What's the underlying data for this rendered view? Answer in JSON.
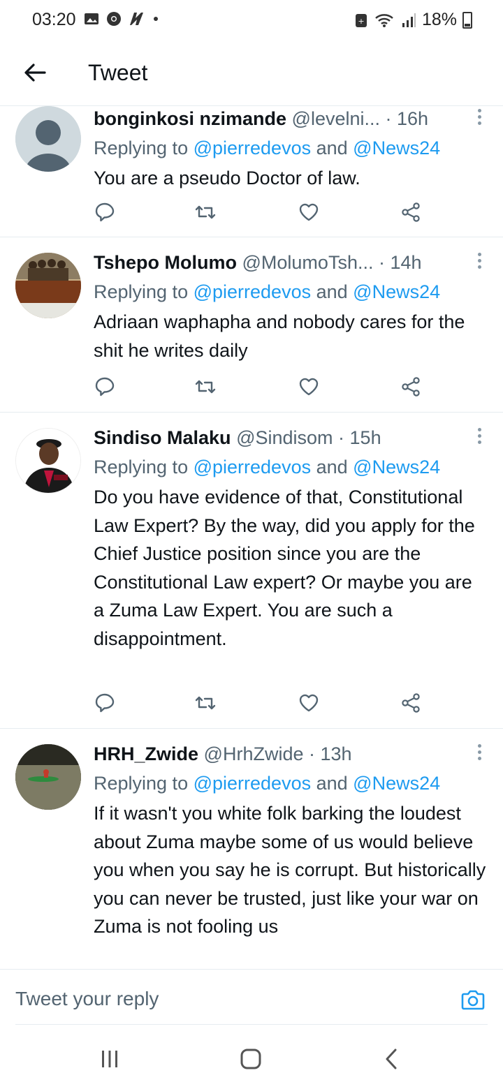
{
  "status_bar": {
    "time": "03:20",
    "battery": "18%",
    "icons": [
      "gallery-icon",
      "chrome-icon",
      "news-icon",
      "notification-dot",
      "battery-saver-icon",
      "wifi-icon",
      "signal-icon",
      "battery-icon"
    ]
  },
  "header": {
    "title": "Tweet"
  },
  "tweets": [
    {
      "name": "bonginkosi nzimande",
      "handle": "@levelni...",
      "time": "· 16h",
      "replying_prefix": "Replying to ",
      "mention1": "@pierredevos",
      "and": " and ",
      "mention2": "@News24",
      "text": "You are a pseudo Doctor of law."
    },
    {
      "name": "Tshepo Molumo",
      "handle": "@MolumoTsh...",
      "time": "· 14h",
      "replying_prefix": "Replying to ",
      "mention1": "@pierredevos",
      "and": " and ",
      "mention2": "@News24",
      "text": "Adriaan waphapha and nobody cares for the shit he writes daily",
      "avatar_text": "IF WE STAND TALL IT IS BECAUSE WE STAND ON THE SHOULDERS OF MANY ANCESTORS"
    },
    {
      "name": "Sindiso Malaku",
      "handle": "@Sindisom",
      "time": "· 15h",
      "replying_prefix": "Replying to ",
      "mention1": "@pierredevos",
      "and": " and ",
      "mention2": "@News24",
      "text": "Do you have evidence of that, Constitutional Law Expert? By the way, did you apply for the Chief Justice position since you are the Constitutional Law expert? Or maybe you are a Zuma Law Expert. You are such a disappointment."
    },
    {
      "name": "HRH_Zwide",
      "handle": "@HrhZwide",
      "time": "· 13h",
      "replying_prefix": "Replying to ",
      "mention1": "@pierredevos",
      "and": " and ",
      "mention2": "@News24",
      "text": "If it wasn't you white folk barking the loudest about Zuma maybe some of us would believe you when you say he is corrupt. But historically you can never be trusted, just like your war on Zuma is not fooling us"
    }
  ],
  "reply_bar": {
    "placeholder": "Tweet your reply"
  },
  "colors": {
    "link": "#1d9bf0",
    "secondary_text": "#536471",
    "divider": "#e6ecf0"
  }
}
